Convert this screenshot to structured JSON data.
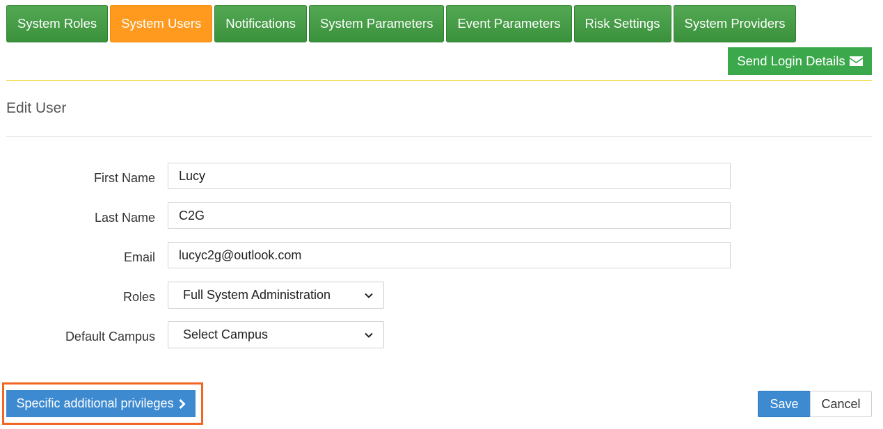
{
  "tabs": [
    {
      "label": "System Roles",
      "active": false
    },
    {
      "label": "System Users",
      "active": true
    },
    {
      "label": "Notifications",
      "active": false
    },
    {
      "label": "System Parameters",
      "active": false
    },
    {
      "label": "Event Parameters",
      "active": false
    },
    {
      "label": "Risk Settings",
      "active": false
    },
    {
      "label": "System Providers",
      "active": false
    }
  ],
  "send_login": {
    "label": "Send Login Details",
    "icon": "envelope-icon"
  },
  "page_title": "Edit User",
  "form": {
    "first_name": {
      "label": "First Name",
      "value": "Lucy"
    },
    "last_name": {
      "label": "Last Name",
      "value": "C2G"
    },
    "email": {
      "label": "Email",
      "value": "lucyc2g@outlook.com"
    },
    "roles": {
      "label": "Roles",
      "selected": "Full System Administration"
    },
    "default_campus": {
      "label": "Default Campus",
      "selected": "Select Campus"
    }
  },
  "actions": {
    "privileges_label": "Specific additional privileges",
    "save_label": "Save",
    "cancel_label": "Cancel"
  },
  "colors": {
    "tab_green": "#43a047",
    "tab_active_orange": "#ff9a1f",
    "send_button_green": "#3ba84b",
    "primary_blue": "#3d8ad0",
    "highlight_orange": "#f26522",
    "rule_yellow": "#f2d52a"
  }
}
